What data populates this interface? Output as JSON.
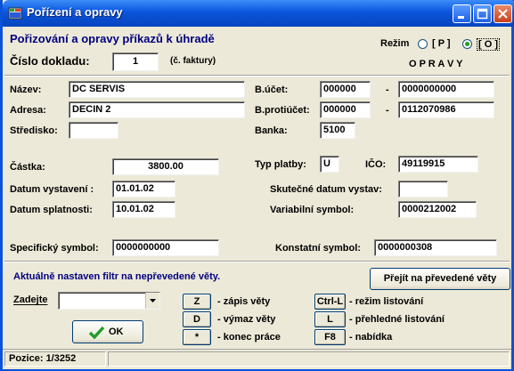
{
  "window": {
    "title": "Pořízení a opravy"
  },
  "header": {
    "heading": "Pořizování a opravy příkazů k úhradě",
    "doc_number_label": "Číslo dokladu:",
    "doc_number_value": "1",
    "doc_note": "(č. faktury)",
    "mode_label": "Režim",
    "mode_p": "[ P ]",
    "mode_o": "[ O ]",
    "mode_selected": "O",
    "mode_title": "O P R A V Y"
  },
  "fields": {
    "nazev_label": "Název:",
    "nazev": "DC SERVIS",
    "adresa_label": "Adresa:",
    "adresa": "DECIN 2",
    "stredisko_label": "Středisko:",
    "stredisko": "",
    "bucet_label": "B.účet:",
    "bucet_prefix": "000000",
    "bucet_number": "0000000000",
    "bprotiucet_label": "B.protiúčet:",
    "bprotiucet_prefix": "000000",
    "bprotiucet_number": "0112070986",
    "dash": "-",
    "banka_label": "Banka:",
    "banka": "5100",
    "castka_label": "Částka:",
    "castka": "3800.00",
    "typ_platby_label": "Typ platby:",
    "typ_platby": "U",
    "ico_label": "IČO:",
    "ico": "49119915",
    "datum_vystaveni_label": "Datum vystavení :",
    "datum_vystaveni": "01.01.02",
    "skutecne_datum_label": "Skutečné datum vystav:",
    "skutecne_datum": "",
    "datum_splatnosti_label": "Datum splatnosti:",
    "datum_splatnosti": "10.01.02",
    "variabilni_label": "Variabilní symbol:",
    "variabilni": "0000212002",
    "specificky_label": "Specifický symbol:",
    "specificky": "0000000000",
    "konstantni_label": "Konstatní symbol:",
    "konstantni": "0000000308"
  },
  "bottom": {
    "filter_text": "Aktuálně nastaven filtr na nepřevedené věty.",
    "switch_button": "Přejít na převedené věty",
    "zadejte_label": "Zadejte",
    "zadejte_value": "",
    "ok_label": "OK",
    "shortcuts": [
      {
        "key": "Z",
        "text": "- zápis věty"
      },
      {
        "key": "D",
        "text": "- výmaz věty"
      },
      {
        "key": "*",
        "text": "- konec práce"
      },
      {
        "key": "Ctrl-L",
        "text": "- režim listování"
      },
      {
        "key": "L",
        "text": "- přehledné listování"
      },
      {
        "key": "F8",
        "text": "- nabídka"
      }
    ]
  },
  "status": {
    "position": "Pozice: 1/3252"
  },
  "colors": {
    "title_bar": "#0a55e0",
    "heading": "#00007f",
    "window_bg": "#ece9d8",
    "ok_check": "#1f9e2a"
  }
}
